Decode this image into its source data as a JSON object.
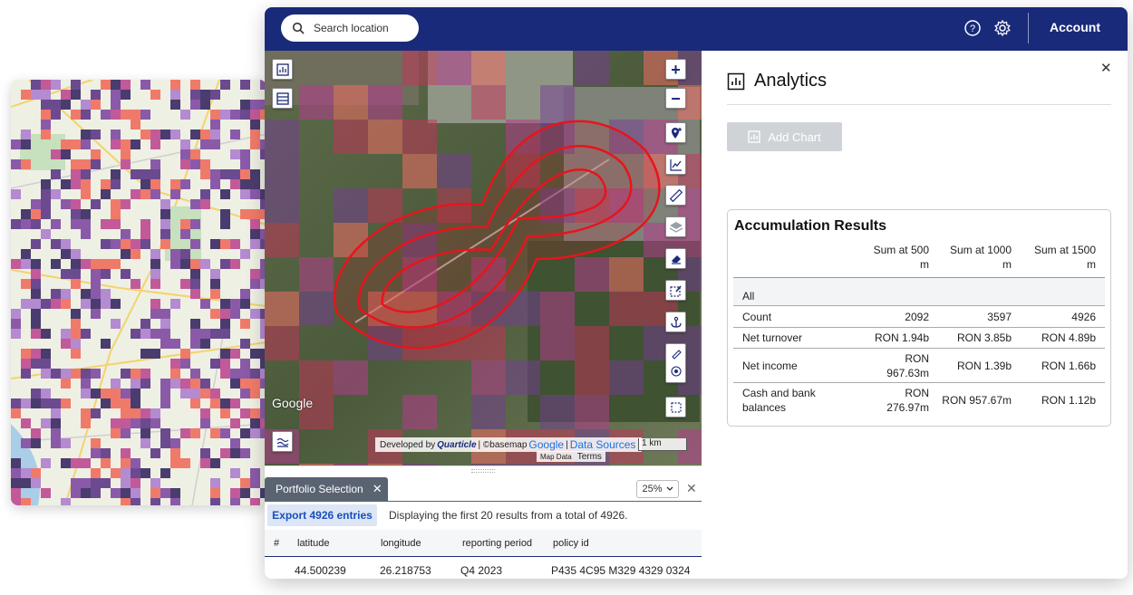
{
  "topbar": {
    "search_placeholder": "Search location",
    "help_icon": "help-circle-icon",
    "settings_icon": "gear-icon",
    "account_label": "Account",
    "bar_color": "#1a2a7a"
  },
  "map": {
    "google_logo": "Google",
    "attribution": {
      "developed_by": "Developed by",
      "brand": "Quarticle",
      "basemap": "| ©basemap",
      "google": "Google",
      "separator": "|",
      "data_sources": "Data Sources"
    },
    "scale": "1 km",
    "map_data": "Map Data",
    "terms": "Terms",
    "zoom_in": "+",
    "zoom_out": "−",
    "buffer_color": "#e8141c",
    "tools": [
      "analytics-icon",
      "table-icon",
      "add-location-icon",
      "line-chart-icon",
      "ruler-icon",
      "layers-icon",
      "eraser-icon",
      "edit-selection-icon",
      "anchor-icon",
      "pencil-icon",
      "target-icon",
      "selection-box-icon",
      "legend-icon"
    ]
  },
  "portfolio": {
    "tab_label": "Portfolio Selection",
    "zoom_value": "25%",
    "export_label": "Export 4926 entries",
    "results_text": "Displaying the first 20 results from a total of 4926.",
    "columns": [
      "#",
      "latitude",
      "longitude",
      "reporting period",
      "policy id"
    ],
    "rows": [
      [
        "",
        "44.500239",
        "26.218753",
        "Q4 2023",
        "P435 4C95 M329 4329 0324"
      ]
    ]
  },
  "analytics": {
    "title": "Analytics",
    "add_chart_label": "Add Chart",
    "results": {
      "title": "Accumulation Results",
      "columns": [
        {
          "line1": "Sum at 500",
          "line2": "m"
        },
        {
          "line1": "Sum at 1000",
          "line2": "m"
        },
        {
          "line1": "Sum at 1500",
          "line2": "m"
        }
      ],
      "group": "All",
      "rows": [
        {
          "label1": "Count",
          "label2": "",
          "values": [
            [
              "2092",
              ""
            ],
            [
              "3597",
              ""
            ],
            [
              "4926",
              ""
            ]
          ]
        },
        {
          "label1": "Net turnover",
          "label2": "",
          "values": [
            [
              "RON 1.94b",
              ""
            ],
            [
              "RON 3.85b",
              ""
            ],
            [
              "RON 4.89b",
              ""
            ]
          ]
        },
        {
          "label1": "Net income",
          "label2": "",
          "values": [
            [
              "RON",
              "967.63m"
            ],
            [
              "RON 1.39b",
              ""
            ],
            [
              "RON 1.66b",
              ""
            ]
          ]
        },
        {
          "label1": "Cash and bank",
          "label2": "balances",
          "values": [
            [
              "RON",
              "276.97m"
            ],
            [
              "RON 957.67m",
              ""
            ],
            [
              "RON 1.12b",
              ""
            ]
          ]
        }
      ]
    }
  }
}
